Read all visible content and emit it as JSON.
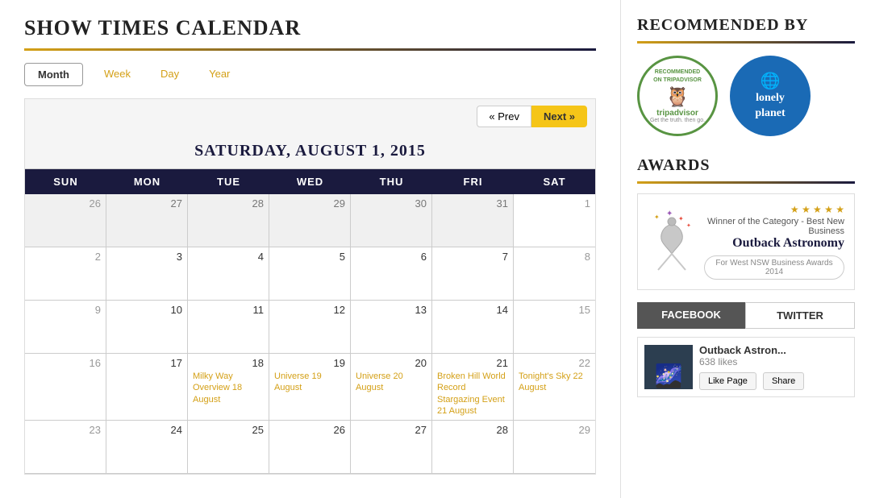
{
  "header": {
    "title": "SHOW TIMES CALENDAR"
  },
  "tabs": [
    {
      "label": "Month",
      "active": true
    },
    {
      "label": "Week",
      "active": false
    },
    {
      "label": "Day",
      "active": false
    },
    {
      "label": "Year",
      "active": false
    }
  ],
  "calendar": {
    "nav": {
      "prev_label": "« Prev",
      "next_label": "Next »"
    },
    "current_date": "SATURDAY, AUGUST 1, 2015",
    "day_headers": [
      "SUN",
      "MON",
      "TUE",
      "WED",
      "THU",
      "FRI",
      "SAT"
    ],
    "weeks": [
      {
        "days": [
          {
            "date": "26",
            "other_month": true,
            "events": []
          },
          {
            "date": "27",
            "other_month": true,
            "events": []
          },
          {
            "date": "28",
            "other_month": true,
            "events": []
          },
          {
            "date": "29",
            "other_month": true,
            "events": []
          },
          {
            "date": "30",
            "other_month": true,
            "events": []
          },
          {
            "date": "31",
            "other_month": true,
            "events": []
          },
          {
            "date": "1",
            "other_month": false,
            "events": []
          }
        ]
      },
      {
        "days": [
          {
            "date": "2",
            "other_month": false,
            "events": []
          },
          {
            "date": "3",
            "other_month": false,
            "events": []
          },
          {
            "date": "4",
            "other_month": false,
            "events": []
          },
          {
            "date": "5",
            "other_month": false,
            "events": []
          },
          {
            "date": "6",
            "other_month": false,
            "events": []
          },
          {
            "date": "7",
            "other_month": false,
            "events": []
          },
          {
            "date": "8",
            "other_month": false,
            "events": []
          }
        ]
      },
      {
        "days": [
          {
            "date": "9",
            "other_month": false,
            "events": []
          },
          {
            "date": "10",
            "other_month": false,
            "events": []
          },
          {
            "date": "11",
            "other_month": false,
            "events": []
          },
          {
            "date": "12",
            "other_month": false,
            "events": []
          },
          {
            "date": "13",
            "other_month": false,
            "events": []
          },
          {
            "date": "14",
            "other_month": false,
            "events": []
          },
          {
            "date": "15",
            "other_month": false,
            "events": []
          }
        ]
      },
      {
        "days": [
          {
            "date": "16",
            "other_month": false,
            "events": []
          },
          {
            "date": "17",
            "other_month": false,
            "events": []
          },
          {
            "date": "18",
            "other_month": false,
            "events": [
              "Milky Way Overview 18 August"
            ]
          },
          {
            "date": "19",
            "other_month": false,
            "events": [
              "Universe 19 August"
            ]
          },
          {
            "date": "20",
            "other_month": false,
            "events": [
              "Universe 20 August"
            ]
          },
          {
            "date": "21",
            "other_month": false,
            "events": [
              "Broken Hill World Record Stargazing Event 21 August"
            ]
          },
          {
            "date": "22",
            "other_month": false,
            "events": [
              "Tonight's Sky 22 August"
            ]
          }
        ]
      },
      {
        "days": [
          {
            "date": "23",
            "other_month": false,
            "events": []
          },
          {
            "date": "24",
            "other_month": false,
            "events": []
          },
          {
            "date": "25",
            "other_month": false,
            "events": []
          },
          {
            "date": "26",
            "other_month": false,
            "events": []
          },
          {
            "date": "27",
            "other_month": false,
            "events": []
          },
          {
            "date": "28",
            "other_month": false,
            "events": []
          },
          {
            "date": "29",
            "other_month": false,
            "events": []
          }
        ]
      }
    ]
  },
  "sidebar": {
    "recommended_title": "RECOMMENDED BY",
    "tripadvisor": {
      "top_text": "RECOMMENDED ON TRIPADVISOR",
      "name": "tripadvisor",
      "sub": "Get the truth. then go."
    },
    "lonely_planet": {
      "line1": "lonely",
      "line2": "planet"
    },
    "awards_title": "AWARDS",
    "award": {
      "stars": "★ ★ ★ ★ ★",
      "category": "Winner of the Category - Best New Business",
      "name": "Outback Astronomy",
      "sub": "For West NSW Business Awards 2014"
    },
    "facebook_label": "FACEBOOK",
    "twitter_label": "TWITTER",
    "fb_page": {
      "name": "Outback Astron...",
      "likes": "638 likes",
      "like_btn": "Like Page",
      "share_btn": "Share"
    }
  }
}
